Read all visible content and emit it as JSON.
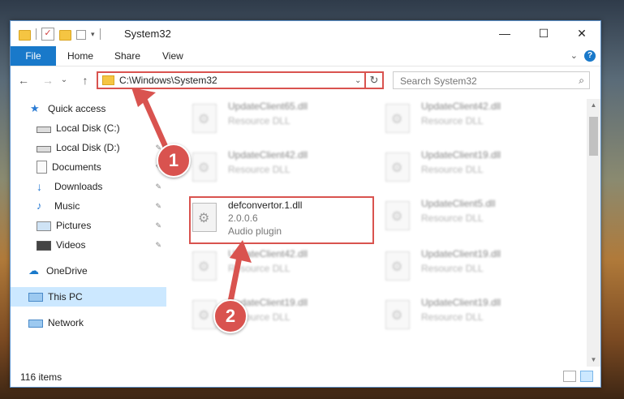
{
  "window": {
    "title": "System32",
    "controls": {
      "minimize": "—",
      "maximize": "☐",
      "close": "✕"
    }
  },
  "ribbon": {
    "tabs": [
      "File",
      "Home",
      "Share",
      "View"
    ],
    "help": "?",
    "collapse": "⌄"
  },
  "navbar": {
    "back": "←",
    "forward": "→",
    "recent": "⌄",
    "up": "↑",
    "address": "C:\\Windows\\System32",
    "address_dropdown": "⌄",
    "refresh": "↻",
    "search_placeholder": "Search System32",
    "search_icon": "🔍"
  },
  "sidebar": {
    "items": [
      {
        "label": "Quick access",
        "icon": "star-icon",
        "pinned": false
      },
      {
        "label": "Local Disk (C:)",
        "icon": "drive-icon",
        "pinned": true
      },
      {
        "label": "Local Disk (D:)",
        "icon": "drive-icon",
        "pinned": true
      },
      {
        "label": "Documents",
        "icon": "documents-icon",
        "pinned": true
      },
      {
        "label": "Downloads",
        "icon": "download-icon",
        "pinned": true
      },
      {
        "label": "Music",
        "icon": "music-icon",
        "pinned": true
      },
      {
        "label": "Pictures",
        "icon": "pictures-icon",
        "pinned": true
      },
      {
        "label": "Videos",
        "icon": "videos-icon",
        "pinned": true
      },
      {
        "label": "OneDrive",
        "icon": "cloud-icon",
        "pinned": false
      },
      {
        "label": "This PC",
        "icon": "computer-icon",
        "pinned": false,
        "selected": true
      },
      {
        "label": "Network",
        "icon": "network-icon",
        "pinned": false
      }
    ],
    "pin_glyph": "📌"
  },
  "files": {
    "left": [
      {
        "name": "UpdateClient65.dll",
        "type": "Resource DLL"
      },
      {
        "name": "UpdateClient42.dll",
        "type": "Resource DLL"
      },
      {
        "name": "defconvertor.1.dll",
        "version": "2.0.0.6",
        "type": "Audio plugin",
        "highlighted": true
      },
      {
        "name": "UpdateClient42.dll",
        "type": "Resource DLL"
      },
      {
        "name": "UpdateClient19.dll",
        "type": "Resource DLL"
      }
    ],
    "right": [
      {
        "name": "UpdateClient42.dll",
        "type": "Resource DLL"
      },
      {
        "name": "UpdateClient19.dll",
        "type": "Resource DLL"
      },
      {
        "name": "UpdateClient5.dll",
        "type": "Resource DLL"
      },
      {
        "name": "UpdateClient19.dll",
        "type": "Resource DLL"
      },
      {
        "name": "UpdateClient19.dll",
        "type": "Resource DLL"
      }
    ]
  },
  "status": {
    "item_count": "116 items"
  },
  "annotations": {
    "badge1": "1",
    "badge2": "2",
    "color": "#d9534f"
  }
}
